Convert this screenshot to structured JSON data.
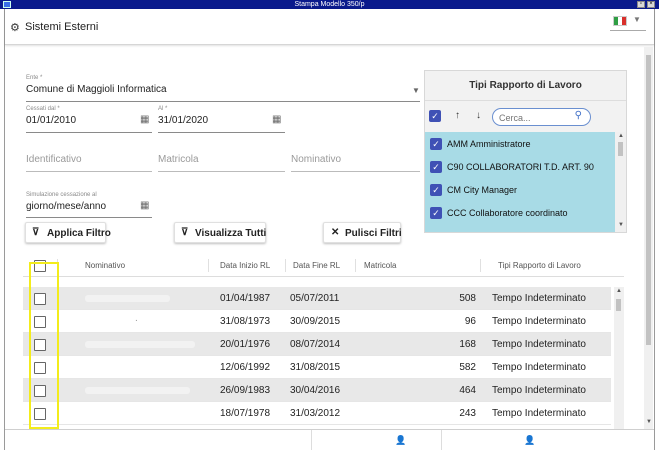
{
  "window": {
    "title": "Stampa Modello 350/p"
  },
  "header": {
    "title": "Sistemi Esterni",
    "icon": "gear-icon",
    "language_flag": "italian-flag-icon",
    "flag_colors": [
      "#2f9e44",
      "#ffffff",
      "#d9302c"
    ]
  },
  "filters": {
    "ente": {
      "label": "Ente *",
      "value": "Comune di Maggioli Informatica"
    },
    "cessati_dal": {
      "label": "Cessati dal *",
      "value": "01/01/2010"
    },
    "al": {
      "label": "Al *",
      "value": "31/01/2020"
    },
    "identificativo": {
      "placeholder": "Identificativo"
    },
    "matricola": {
      "placeholder": "Matricola"
    },
    "nominativo": {
      "placeholder": "Nominativo"
    },
    "simulazione": {
      "label": "Simulazione cessazione al",
      "value": "giorno/mese/anno"
    }
  },
  "tipi_panel": {
    "title": "Tipi Rapporto di Lavoro",
    "search_placeholder": "Cerca...",
    "items": [
      {
        "label": "AMM Amministratore",
        "checked": true
      },
      {
        "label": "C90 COLLABORATORI T.D. ART. 90",
        "checked": true
      },
      {
        "label": "CM City Manager",
        "checked": true
      },
      {
        "label": "CCC Collaboratore coordinato",
        "checked": true
      }
    ]
  },
  "buttons": {
    "applica": "Applica Filtro",
    "visualizza": "Visualizza Tutti",
    "pulisci": "Pulisci Filtri"
  },
  "grid": {
    "columns": [
      "Nominativo",
      "Data Inizio RL",
      "Data Fine RL",
      "Matricola",
      "Tipi Rapporto di Lavoro"
    ],
    "rows": [
      {
        "inizio": "01/04/1987",
        "fine": "05/07/2011",
        "matricola": "508",
        "tipo": "Tempo Indeterminato"
      },
      {
        "inizio": "31/08/1973",
        "fine": "30/09/2015",
        "matricola": "96",
        "tipo": "Tempo Indeterminato"
      },
      {
        "inizio": "20/01/1976",
        "fine": "08/07/2014",
        "matricola": "168",
        "tipo": "Tempo Indeterminato"
      },
      {
        "inizio": "12/06/1992",
        "fine": "31/08/2015",
        "matricola": "582",
        "tipo": "Tempo Indeterminato"
      },
      {
        "inizio": "26/09/1983",
        "fine": "30/04/2016",
        "matricola": "464",
        "tipo": "Tempo Indeterminato"
      },
      {
        "inizio": "18/07/1978",
        "fine": "31/03/2012",
        "matricola": "243",
        "tipo": "Tempo Indeterminato"
      }
    ]
  },
  "colors": {
    "accent": "#3f51b5",
    "list_bg": "#a8dbe6",
    "highlight": "#f3ec1b",
    "titlebar": "#0a1a8c"
  }
}
